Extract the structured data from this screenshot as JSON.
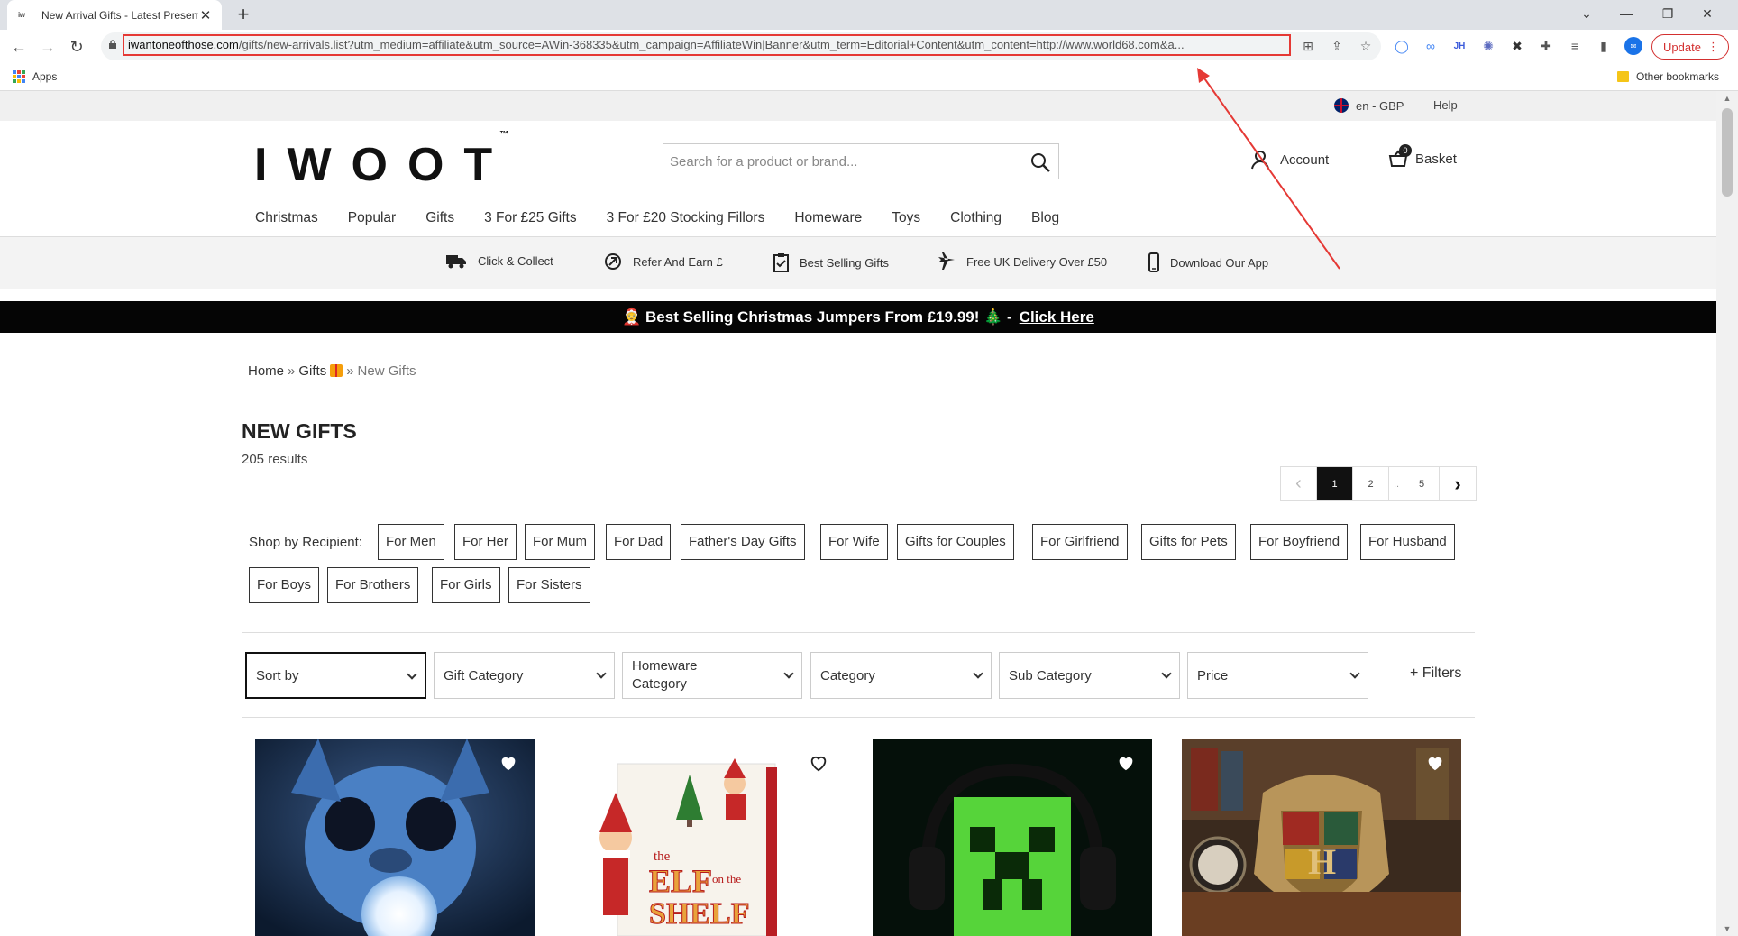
{
  "browser": {
    "tab_title": "New Arrival Gifts - Latest Presents",
    "tab_favicon": "iw",
    "new_tab": "+",
    "url_host": "iwantoneofthose.com",
    "url_path": "/gifts/new-arrivals.list?utm_medium=affiliate&utm_source=AWin-368335&utm_campaign=AffiliateWin|Banner&utm_term=Editorial+Content&utm_content=http://www.world68.com&a...",
    "update_label": "Update",
    "bookmarks_apps": "Apps",
    "bookmarks_other": "Other bookmarks",
    "accent": "#e53935"
  },
  "site": {
    "locale": "en - GBP",
    "help": "Help",
    "logo": "IWOOT",
    "logo_tm": "™",
    "search_placeholder": "Search for a product or brand...",
    "account": "Account",
    "basket": "Basket",
    "basket_count": "0",
    "nav": [
      "Christmas",
      "Popular",
      "Gifts",
      "3 For £25 Gifts",
      "3 For £20 Stocking Fillors",
      "Homeware",
      "Toys",
      "Clothing",
      "Blog"
    ],
    "benefits": [
      {
        "label": "Click & Collect",
        "icon": "truck-icon"
      },
      {
        "label": "Refer And Earn £",
        "icon": "refer-icon"
      },
      {
        "label": "Best Selling Gifts",
        "icon": "clipboard-check-icon"
      },
      {
        "label": "Free UK Delivery Over £50",
        "icon": "plane-icon"
      },
      {
        "label": "Download Our App",
        "icon": "phone-icon"
      }
    ],
    "promo_text": "🤶 Best Selling Christmas Jumpers From £19.99! 🎄 -",
    "promo_link": "Click Here"
  },
  "breadcrumb": {
    "home": "Home",
    "sep": "»",
    "gifts": "Gifts",
    "current": "New Gifts"
  },
  "listing": {
    "title": "NEW GIFTS",
    "results": "205 results",
    "pager": {
      "prev": "‹",
      "pages": [
        "1",
        "2",
        "..",
        "5"
      ],
      "next": "›",
      "active": "1"
    },
    "recipient_label": "Shop by Recipient:",
    "recipients": [
      "For Men",
      "For Her",
      "For Mum",
      "For Dad",
      "Father's Day Gifts",
      "For Wife",
      "Gifts for Couples",
      "For Girlfriend",
      "Gifts for Pets",
      "For Boyfriend",
      "For Husband",
      "For Boys",
      "For Brothers",
      "For Girls",
      "For Sisters"
    ],
    "filters": [
      "Sort by",
      "Gift Category",
      "Homeware Category",
      "Category",
      "Sub Category",
      "Price"
    ],
    "more_filters": "+ Filters"
  }
}
